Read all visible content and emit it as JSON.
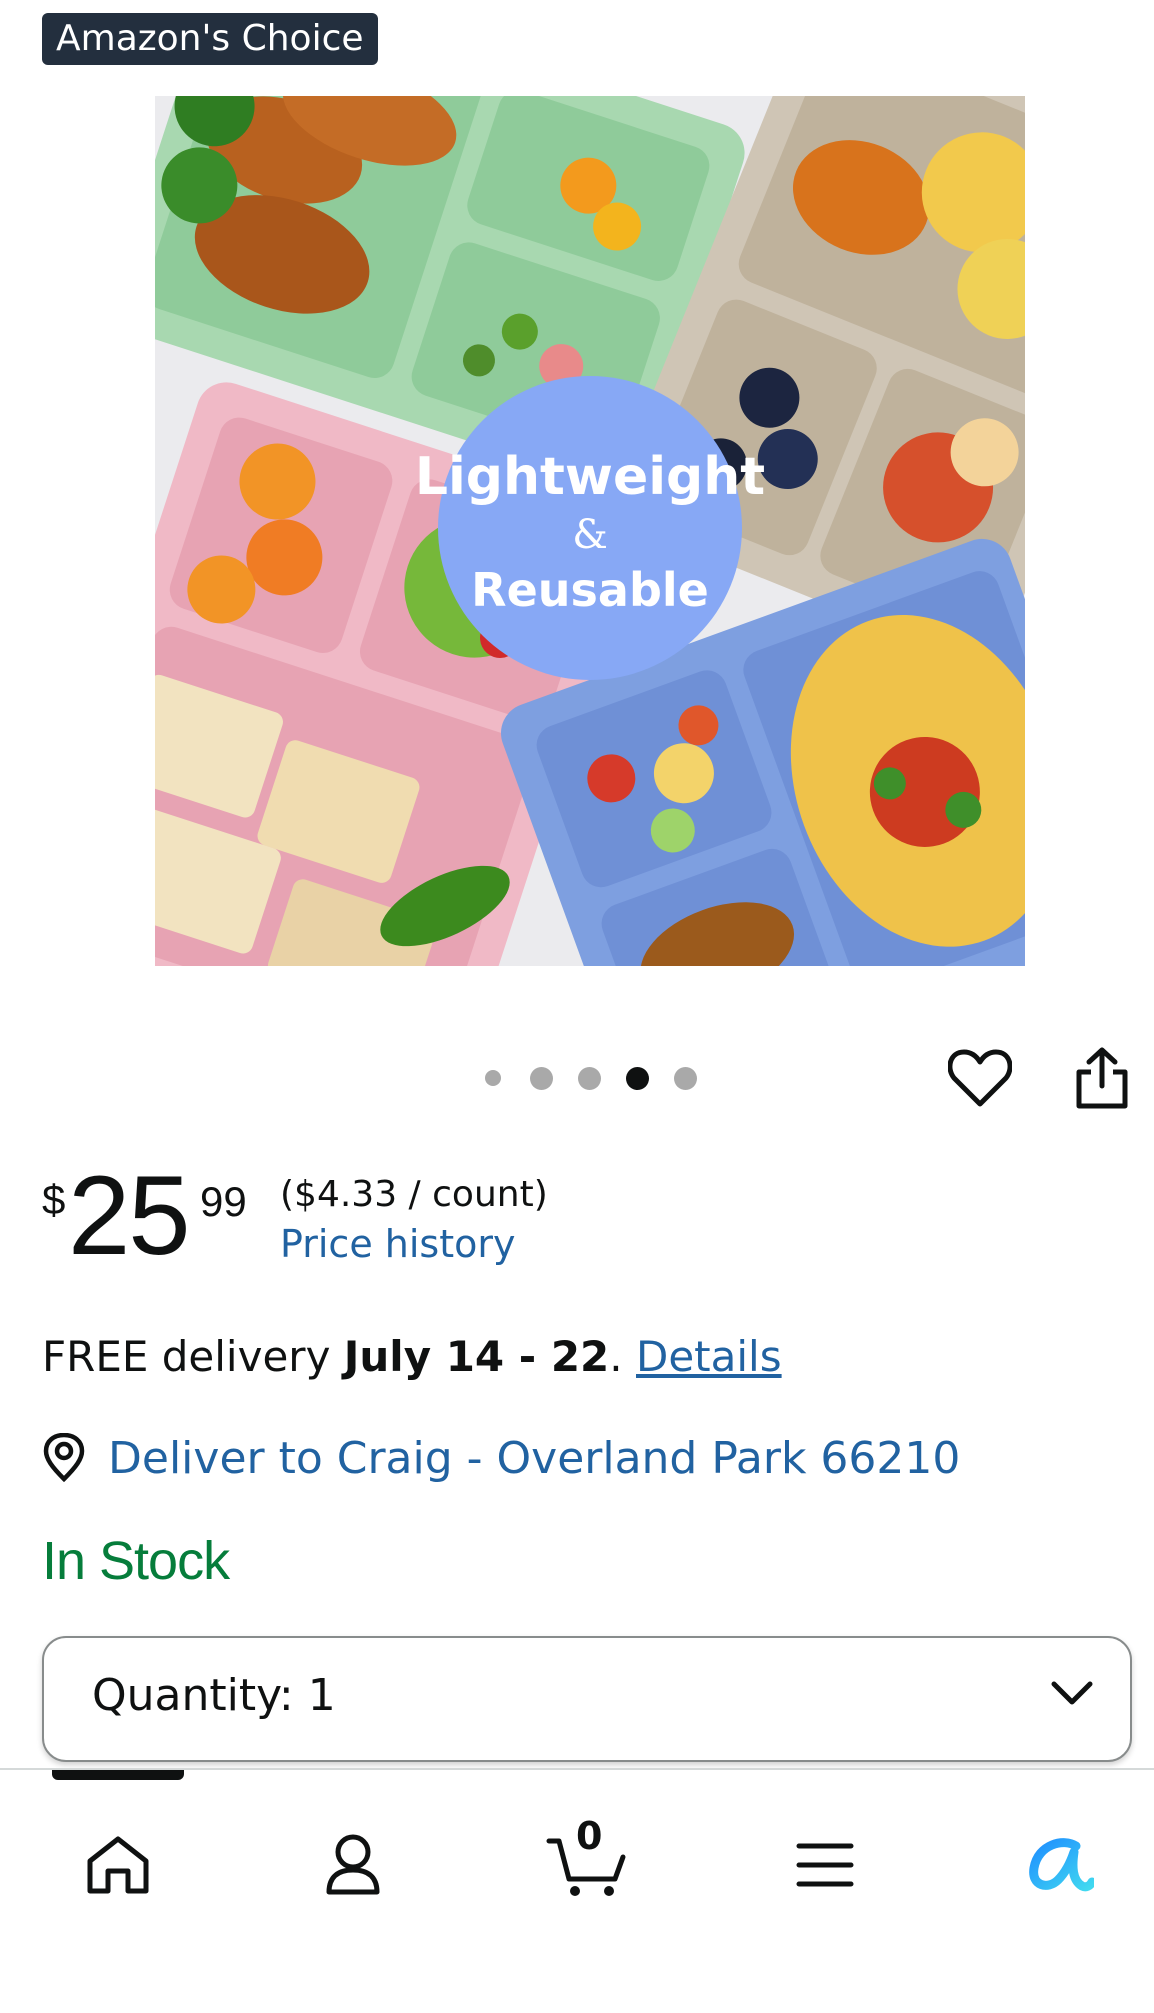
{
  "badge": {
    "label": "Amazon's Choice"
  },
  "image": {
    "overlay_line1": "Lightweight",
    "overlay_line2": "&",
    "overlay_line3": "Reusable",
    "pager": {
      "count": 5,
      "active_index": 3
    }
  },
  "actions": {
    "favorite_icon": "heart-icon",
    "share_icon": "share-icon"
  },
  "price": {
    "currency": "$",
    "whole": "25",
    "fraction": "99",
    "unit_price": "($4.33 / count)",
    "history_link": "Price history"
  },
  "delivery": {
    "prefix": "FREE delivery",
    "dates": "July 14 - 22",
    "period": ".",
    "details_link": "Details",
    "deliver_to": "Deliver to Craig - Overland Park 66210"
  },
  "stock": {
    "status": "In Stock"
  },
  "quantity": {
    "label": "Quantity:",
    "value": "1"
  },
  "nav": {
    "items": [
      "home-icon",
      "account-icon",
      "cart-icon",
      "menu-icon",
      "rufus-ai-icon"
    ],
    "cart_count": "0"
  },
  "colors": {
    "link": "#2162a1",
    "stock": "#067d3b",
    "badge_bg": "#232f3e",
    "overlay_circle": "#87a8f5"
  }
}
